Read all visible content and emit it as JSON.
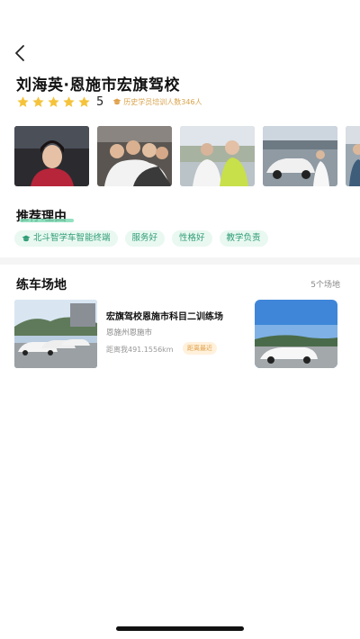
{
  "header": {
    "coach_name": "刘海英·恩施市宏旗驾校",
    "rating_score": 5,
    "rating_value": "5",
    "trained_count": "历史学员培训人数346人"
  },
  "photos": [
    {
      "name": "coach-photo-1"
    },
    {
      "name": "coach-photo-2"
    },
    {
      "name": "coach-photo-3"
    },
    {
      "name": "coach-photo-4"
    },
    {
      "name": "coach-photo-5"
    }
  ],
  "reasons": {
    "title": "推荐理由",
    "tags": [
      "北斗智学车智能终端",
      "服务好",
      "性格好",
      "教学负责"
    ]
  },
  "fields": {
    "title": "练车场地",
    "count": "5个场地",
    "items": [
      {
        "name": "宏旗驾校恩施市科目二训练场",
        "area": "恩施州恩施市",
        "distance": "距离我491.1556km",
        "badge": "距离最近"
      }
    ]
  },
  "colors": {
    "star": "#f5c33b",
    "tag_bg": "#e9f8f1",
    "tag_text": "#2f9d76",
    "badge_bg": "#fff1dc",
    "badge_text": "#e0a14a"
  }
}
